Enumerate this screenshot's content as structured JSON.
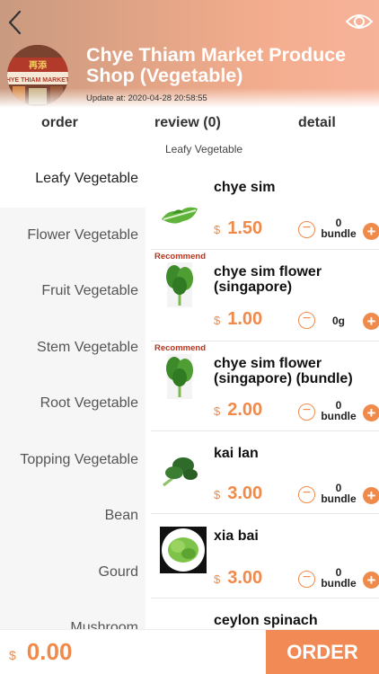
{
  "header": {
    "shop_name": "Chye Thiam Market Produce Shop (Vegetable)",
    "update_label": "Update at:",
    "update_time": "2020-04-28 20:58:55",
    "logo_text": "HYE THIAM MARKET"
  },
  "tabs": [
    {
      "label": "order"
    },
    {
      "label": "review (0)"
    },
    {
      "label": "detail"
    }
  ],
  "categories": [
    {
      "label": "Leafy Vegetable",
      "active": true
    },
    {
      "label": "Flower Vegetable"
    },
    {
      "label": "Fruit Vegetable"
    },
    {
      "label": "Stem Vegetable"
    },
    {
      "label": "Root Vegetable"
    },
    {
      "label": "Topping Vegetable"
    },
    {
      "label": "Bean"
    },
    {
      "label": "Gourd"
    },
    {
      "label": "Mushroom"
    }
  ],
  "section_title": "Leafy Vegetable",
  "products": [
    {
      "name": "chye sim",
      "recommend": "",
      "currency": "$",
      "price": "1.50",
      "qty": "0",
      "unit": "bundle"
    },
    {
      "name": "chye sim flower (singapore)",
      "recommend": "Recommend",
      "currency": "$",
      "price": "1.00",
      "qty": "0",
      "unit": "g"
    },
    {
      "name": "chye sim flower (singapore) (bundle)",
      "recommend": "Recommend",
      "currency": "$",
      "price": "2.00",
      "qty": "0",
      "unit": "bundle"
    },
    {
      "name": "kai lan",
      "recommend": "",
      "currency": "$",
      "price": "3.00",
      "qty": "0",
      "unit": "bundle"
    },
    {
      "name": "xia bai",
      "recommend": "",
      "currency": "$",
      "price": "3.00",
      "qty": "0",
      "unit": "bundle"
    },
    {
      "name": "ceylon spinach",
      "recommend": "",
      "currency": "$",
      "price": "",
      "qty": "",
      "unit": ""
    }
  ],
  "footer": {
    "currency": "$",
    "total": "0.00",
    "order_label": "ORDER"
  },
  "colors": {
    "accent": "#f08a4b",
    "order_button": "#f28a55",
    "recommend": "#b5361e",
    "header_gradient_start": "#c99a80",
    "header_gradient_end": "#f7b39a"
  },
  "icons": {
    "back": "chevron-left-icon",
    "view": "eye-icon",
    "minus": "minus-circle-icon",
    "plus": "plus-circle-icon"
  }
}
